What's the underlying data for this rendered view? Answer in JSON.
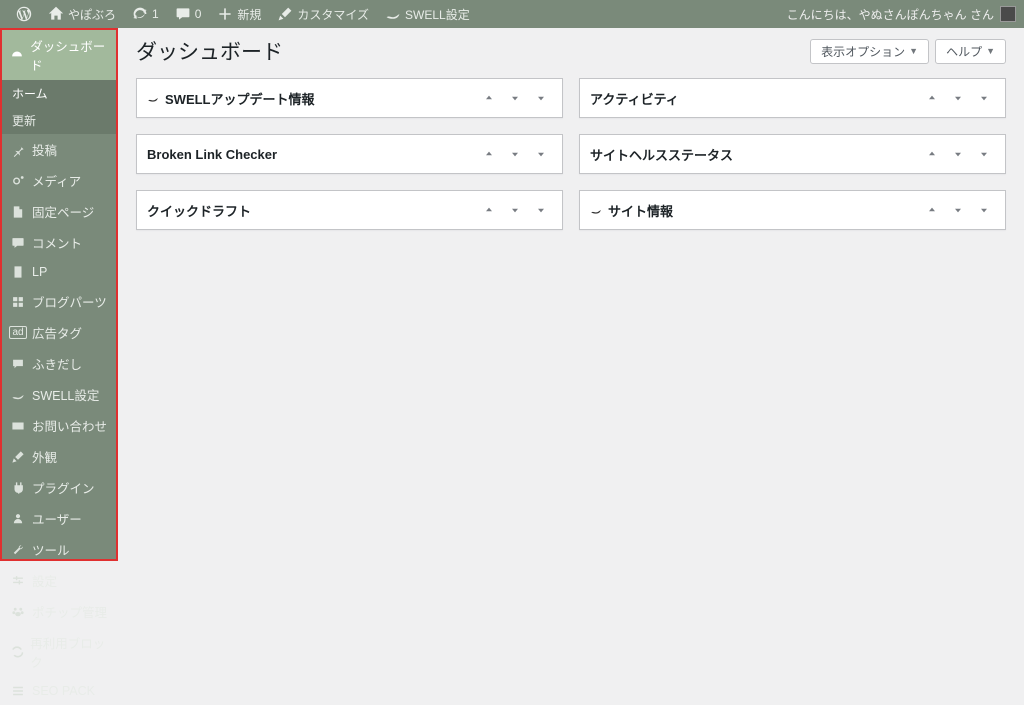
{
  "adminbar": {
    "site_name": "やぽぶろ",
    "update_count": "1",
    "comment_count": "0",
    "new_label": "新規",
    "customize_label": "カスタマイズ",
    "swell_label": "SWELL設定",
    "greeting": "こんにちは、やぬさんぽんちゃん さん"
  },
  "sidebar": {
    "dashboard": "ダッシュボード",
    "home": "ホーム",
    "updates": "更新",
    "posts": "投稿",
    "media": "メディア",
    "pages": "固定ページ",
    "comments": "コメント",
    "lp": "LP",
    "blog_parts": "ブログパーツ",
    "ad_tag": "広告タグ",
    "balloon": "ふきだし",
    "swell": "SWELL設定",
    "contact": "お問い合わせ",
    "appearance": "外観",
    "plugins": "プラグイン",
    "users": "ユーザー",
    "tools": "ツール",
    "settings": "設定",
    "pochipp": "ポチップ管理",
    "reusable": "再利用ブロック",
    "seo": "SEO PACK"
  },
  "main": {
    "title": "ダッシュボード",
    "screen_options": "表示オプション",
    "help": "ヘルプ"
  },
  "boxes": {
    "left": [
      {
        "title": "SWELLアップデート情報",
        "icon": true
      },
      {
        "title": "Broken Link Checker",
        "icon": false
      },
      {
        "title": "クイックドラフト",
        "icon": false
      }
    ],
    "right": [
      {
        "title": "アクティビティ",
        "icon": false
      },
      {
        "title": "サイトヘルスステータス",
        "icon": false
      },
      {
        "title": "サイト情報",
        "icon": true
      }
    ]
  }
}
